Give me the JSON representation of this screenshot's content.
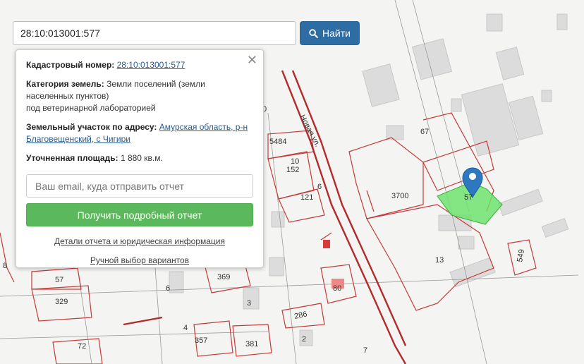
{
  "search": {
    "value": "28:10:013001:577",
    "button_label": "Найти"
  },
  "popup": {
    "cadastral_label": "Кадастровый номер:",
    "cadastral_value": "28:10:013001:577",
    "category_label": "Категория земель:",
    "category_value": "Земли поселений (земли населенных пунктов)",
    "category_purpose": "под ветеринарной лабораторией",
    "address_label": "Земельный участок по адресу:",
    "address_value": "Амурская область, р-н Благовещенский, с Чигири",
    "area_label": "Уточненная площадь:",
    "area_value": "1 880 кв.м.",
    "email_placeholder": "Ваш email, куда отправить отчет",
    "report_button": "Получить подробный отчет",
    "details_link": "Детали отчета и юридическая информация",
    "manual_link": "Ручной выбор вариантов"
  },
  "map": {
    "street_name": "Новая ул.",
    "labels": {
      "l5484": "5484",
      "l152": "152",
      "l10": "10",
      "l121": "121",
      "l6a": "6",
      "l3700": "3700",
      "l67": "67",
      "l57_plot": "57",
      "l13": "13",
      "l549": "549",
      "l369": "369",
      "l57": "57",
      "l329": "329",
      "l80": "80",
      "l286": "286",
      "l6b": "6",
      "l3": "3",
      "l4": "4",
      "l357": "357",
      "l381": "381",
      "l72": "72",
      "l2": "2",
      "l7": "7",
      "l8": "8",
      "l0": "0"
    }
  },
  "colors": {
    "parcel_line": "#c53a3a",
    "selected_parcel": "#6ee36e",
    "marker": "#2e78c2",
    "primary_button": "#2e6da4",
    "success_button": "#5cb85c"
  }
}
